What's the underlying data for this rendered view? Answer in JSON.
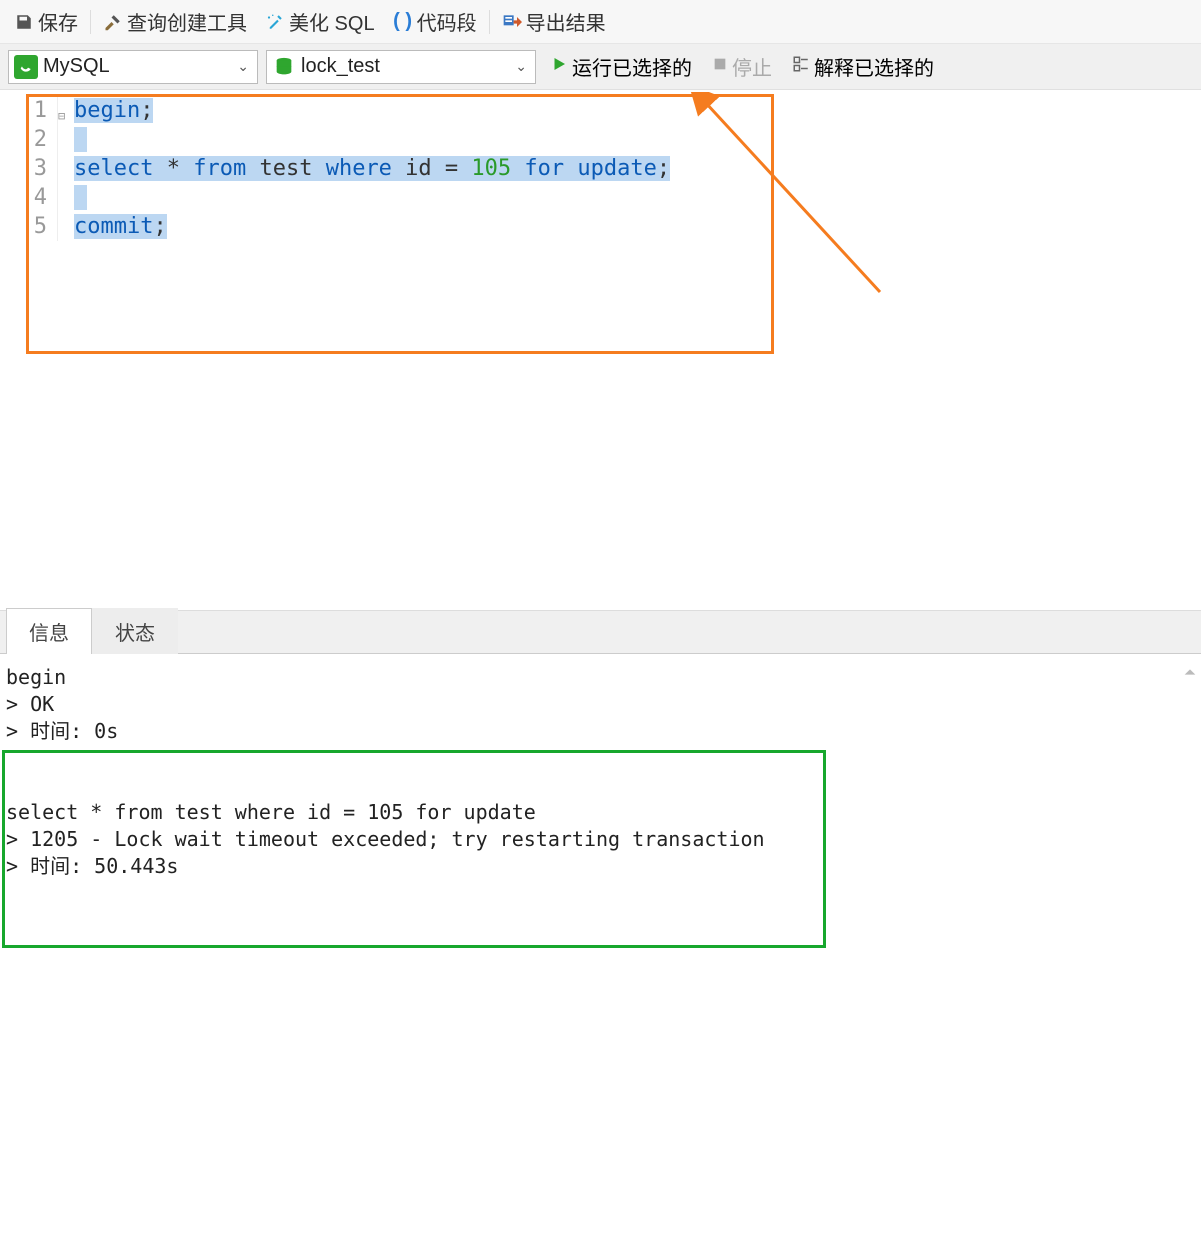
{
  "toolbar": {
    "save": "保存",
    "queryBuilder": "查询创建工具",
    "beautify": "美化 SQL",
    "snippet": "代码段",
    "export": "导出结果"
  },
  "connBar": {
    "connection": "MySQL",
    "database": "lock_test",
    "runSelected": "运行已选择的",
    "stop": "停止",
    "explainSelected": "解释已选择的"
  },
  "editor": {
    "lineNumbers": [
      "1",
      "2",
      "3",
      "4",
      "5"
    ],
    "lines": [
      {
        "tokens": [
          {
            "t": "begin",
            "c": "kw"
          },
          {
            "t": ";",
            "c": "id"
          }
        ]
      },
      {
        "tokens": []
      },
      {
        "tokens": [
          {
            "t": "select",
            "c": "kw"
          },
          {
            "t": " * ",
            "c": "id"
          },
          {
            "t": "from",
            "c": "kw"
          },
          {
            "t": " test ",
            "c": "id"
          },
          {
            "t": "where",
            "c": "kw"
          },
          {
            "t": " id ",
            "c": "id"
          },
          {
            "t": "=",
            "c": "id"
          },
          {
            "t": " ",
            "c": "id"
          },
          {
            "t": "105",
            "c": "num"
          },
          {
            "t": " ",
            "c": "id"
          },
          {
            "t": "for",
            "c": "kw"
          },
          {
            "t": " ",
            "c": "id"
          },
          {
            "t": "update",
            "c": "kw"
          },
          {
            "t": ";",
            "c": "id"
          }
        ]
      },
      {
        "tokens": []
      },
      {
        "tokens": [
          {
            "t": "commit",
            "c": "kw"
          },
          {
            "t": ";",
            "c": "id"
          }
        ]
      }
    ]
  },
  "resultTabs": {
    "info": "信息",
    "status": "状态"
  },
  "console": {
    "block1": [
      "begin",
      "> OK",
      "> 时间: 0s"
    ],
    "block2": [
      "select * from test where id = 105 for update",
      "> 1205 - Lock wait timeout exceeded; try restarting transaction",
      "> 时间: 50.443s"
    ]
  }
}
